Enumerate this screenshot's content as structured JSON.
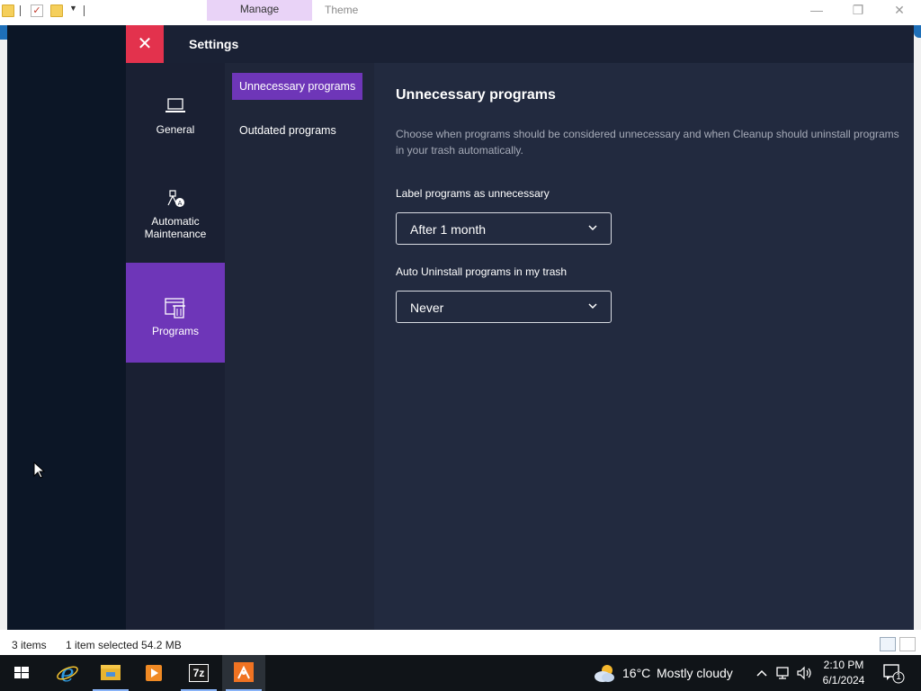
{
  "explorer": {
    "ribbon_tabs": {
      "manage": "Manage",
      "theme": "Theme"
    },
    "controls": {
      "minimize": "—",
      "restore": "❐",
      "close": "✕"
    }
  },
  "settings": {
    "close_icon": "close-icon",
    "title": "Settings",
    "categories": [
      {
        "label": "General",
        "icon": "laptop-icon"
      },
      {
        "label": "Automatic Maintenance",
        "icon": "maintenance-icon"
      },
      {
        "label": "Programs",
        "icon": "programs-trash-icon",
        "active": true
      }
    ],
    "subnav": [
      {
        "label": "Unnecessary programs",
        "active": true
      },
      {
        "label": "Outdated programs",
        "active": false
      }
    ],
    "content": {
      "title": "Unnecessary programs",
      "description": "Choose when programs should be considered unnecessary and when Cleanup should uninstall programs in your trash automatically.",
      "label_unnecessary": "Label programs as unnecessary",
      "unnecessary_value": "After 1 month",
      "auto_uninstall_label": "Auto Uninstall programs in my trash",
      "auto_uninstall_value": "Never"
    },
    "accent_color": "#6e36b8",
    "close_color": "#e3324d"
  },
  "statusbar": {
    "items_count": "3 items",
    "selection": "1 item selected  54.2 MB"
  },
  "taskbar": {
    "apps": [
      "windows-start-icon",
      "internet-explorer-icon",
      "file-explorer-icon",
      "media-player-icon",
      "7zip-icon",
      "avast-cleanup-icon"
    ],
    "seven_zip_label": "7z",
    "weather_temp": "16°C",
    "weather_text": "Mostly cloudy",
    "time": "2:10 PM",
    "date": "6/1/2024",
    "notification_count": "1"
  }
}
